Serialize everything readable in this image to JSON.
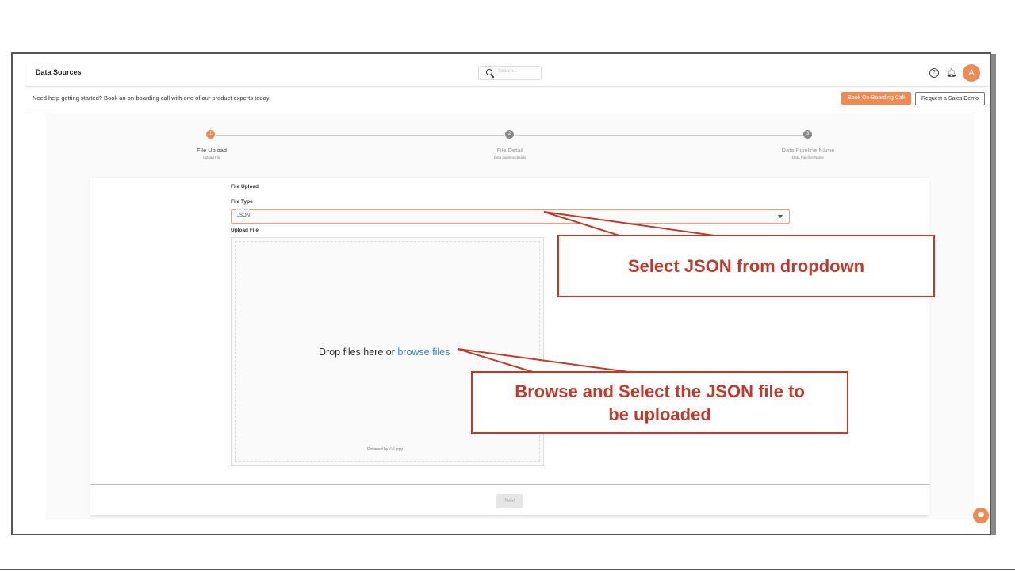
{
  "app": {
    "title": "Data Sources",
    "search_placeholder": "Search...",
    "avatar_letter": "A"
  },
  "helpbar": {
    "text": "Need help getting started? Book an on-boarding call with one of our product experts today.",
    "book_call_label": "Book On-Boarding Call",
    "sales_demo_label": "Request a Sales Demo"
  },
  "steps": [
    {
      "number": "1",
      "title": "File Upload",
      "subtitle": "Upload File",
      "active": true
    },
    {
      "number": "2",
      "title": "File Detail",
      "subtitle": "Data pipeline details",
      "active": false
    },
    {
      "number": "3",
      "title": "Data Pipeline Name",
      "subtitle": "Data Pipeline Name",
      "active": false
    }
  ],
  "form": {
    "section_title": "File Upload",
    "file_type_label": "File Type",
    "file_type_mini_label": "File Type",
    "file_type_value": "JSON",
    "upload_label": "Upload File",
    "drop_text": "Drop files here or",
    "browse_link": "browse files",
    "powered_by": "Powered by ⊙ Uppy",
    "next_label": "Next"
  },
  "annotations": {
    "callout_1": "Select JSON  from dropdown",
    "callout_2_line1": "Browse and Select the JSON file to",
    "callout_2_line2": "be uploaded",
    "color": "#c0392b"
  },
  "colors": {
    "accent": "#f08a55",
    "link": "#3b7fc4",
    "step_inactive": "#8a8a8a"
  }
}
